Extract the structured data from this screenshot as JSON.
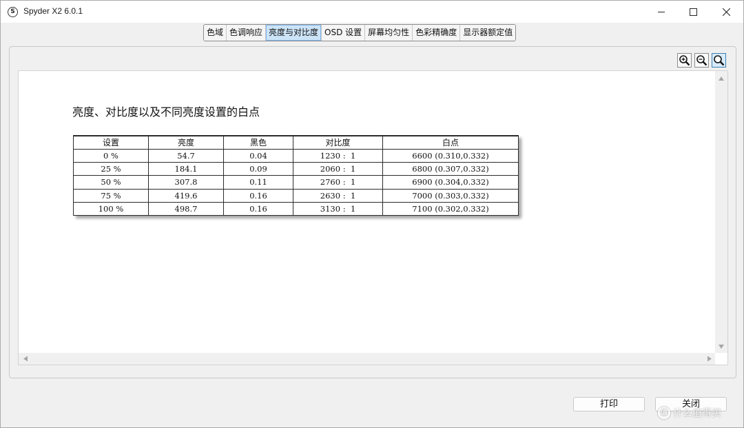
{
  "window": {
    "app_icon_letter": "S",
    "title": "Spyder X2 6.0.1"
  },
  "tabs": [
    {
      "label": "色域"
    },
    {
      "label": "色调响应"
    },
    {
      "label": "亮度与对比度",
      "active": true
    },
    {
      "label": "OSD 设置"
    },
    {
      "label": "屏幕均匀性"
    },
    {
      "label": "色彩精确度"
    },
    {
      "label": "显示器额定值"
    }
  ],
  "zoom_tools": [
    "zoom-in-icon",
    "zoom-out-icon",
    "zoom-fit-icon"
  ],
  "report": {
    "heading": "亮度、对比度以及不同亮度设置的白点",
    "columns": [
      "设置",
      "亮度",
      "黑色",
      "对比度",
      "白点"
    ],
    "rows": [
      [
        "0 %",
        "54.7",
        "0.04",
        "1230 :  1",
        "6600 (0.310,0.332)"
      ],
      [
        "25 %",
        "184.1",
        "0.09",
        "2060 :  1",
        "6800 (0.307,0.332)"
      ],
      [
        "50 %",
        "307.8",
        "0.11",
        "2760 :  1",
        "6900 (0.304,0.332)"
      ],
      [
        "75 %",
        "419.6",
        "0.16",
        "2630 :  1",
        "7000 (0.303,0.332)"
      ],
      [
        "100 %",
        "498.7",
        "0.16",
        "3130 :  1",
        "7100 (0.302,0.332)"
      ]
    ]
  },
  "buttons": {
    "print": "打印",
    "close": "关闭"
  },
  "watermark": {
    "icon_letter": "值",
    "text": "什么值得买"
  },
  "colors": {
    "active_tab": "#cce4f7",
    "active_tab_border": "#7eb4ea"
  }
}
